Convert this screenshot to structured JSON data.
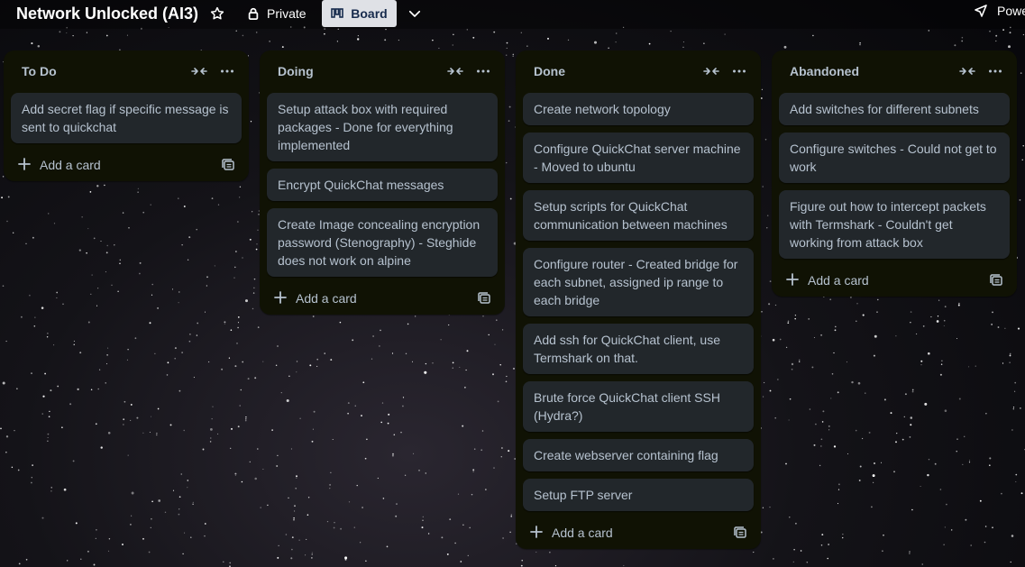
{
  "board": {
    "title": "Network Unlocked (AI3)",
    "visibility": "Private",
    "view": "Board",
    "power_ups": "Power-Ups"
  },
  "colors": {
    "list_bg": "#101204",
    "card_bg": "#22272b",
    "text": "#b6c2cf",
    "board_btn_bg": "#dfe1e6"
  },
  "icons": [
    "star-icon",
    "lock-icon",
    "board-icon",
    "chevron-down-icon",
    "rocket-icon",
    "collapse-icon",
    "more-icon",
    "plus-icon",
    "template-icon"
  ],
  "lists": [
    {
      "title": "To Do",
      "add_label": "Add a card",
      "cards": [
        "Add secret flag if specific message is sent to quickchat"
      ]
    },
    {
      "title": "Doing",
      "add_label": "Add a card",
      "cards": [
        "Setup attack box with required packages - Done for everything implemented",
        "Encrypt QuickChat messages",
        "Create Image concealing encryption password (Stenography) - Steghide does not work on alpine"
      ]
    },
    {
      "title": "Done",
      "add_label": "Add a card",
      "cards": [
        "Create network topology",
        "Configure QuickChat server machine - Moved to ubuntu",
        "Setup scripts for QuickChat communication between machines",
        "Configure router - Created bridge for each subnet, assigned ip range to each bridge",
        "Add ssh for QuickChat client, use Termshark on that.",
        "Brute force QuickChat client SSH (Hydra?)",
        "Create webserver containing flag",
        "Setup FTP server"
      ]
    },
    {
      "title": "Abandoned",
      "add_label": "Add a card",
      "cards": [
        "Add switches for different subnets",
        "Configure switches - Could not get to work",
        "Figure out how to intercept packets with Termshark - Couldn't get working from attack box"
      ]
    }
  ]
}
